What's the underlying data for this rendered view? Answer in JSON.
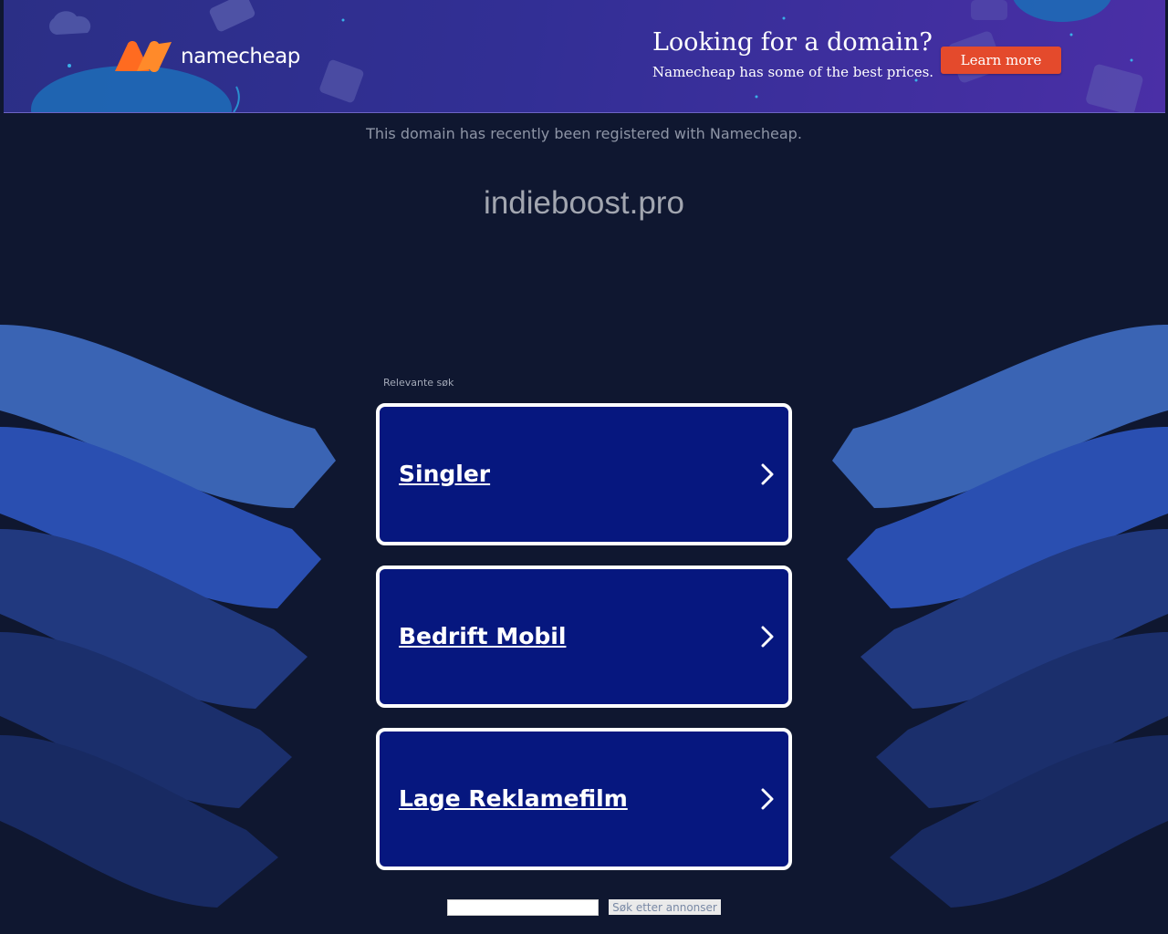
{
  "banner": {
    "logo_wordmark": "namecheap",
    "title": "Looking for a domain?",
    "subtitle": "Namecheap has some of the best prices.",
    "cta_label": "Learn more",
    "accent_color": "#e44a2c",
    "logo_color": "#ff6b20"
  },
  "notice": "This domain has recently been registered with Namecheap.",
  "domain_name": "indieboost.pro",
  "related": {
    "label": "Relevante søk",
    "items": [
      {
        "label": "Singler"
      },
      {
        "label": "Bedrift Mobil"
      },
      {
        "label": "Lage Reklamefilm"
      }
    ]
  },
  "search": {
    "input_value": "",
    "button_label": "Søk etter annonser"
  }
}
